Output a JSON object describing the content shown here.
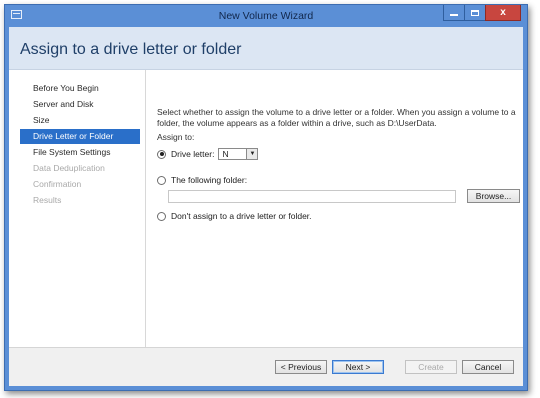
{
  "window": {
    "title": "New Volume Wizard",
    "close_label": "x"
  },
  "header": {
    "title": "Assign to a drive letter or folder"
  },
  "nav": {
    "items": [
      {
        "label": "Before You Begin",
        "state": "normal"
      },
      {
        "label": "Server and Disk",
        "state": "normal"
      },
      {
        "label": "Size",
        "state": "normal"
      },
      {
        "label": "Drive Letter or Folder",
        "state": "active"
      },
      {
        "label": "File System Settings",
        "state": "normal"
      },
      {
        "label": "Data Deduplication",
        "state": "disabled"
      },
      {
        "label": "Confirmation",
        "state": "disabled"
      },
      {
        "label": "Results",
        "state": "disabled"
      }
    ]
  },
  "content": {
    "description": "Select whether to assign the volume to a drive letter or a folder. When you assign a volume to a folder, the volume appears as a folder within a drive, such as D:\\UserData.",
    "assign_to_label": "Assign to:",
    "options": {
      "drive_letter_label": "Drive letter:",
      "drive_letter_value": "N",
      "drive_letter_checked": true,
      "folder_label": "The following folder:",
      "folder_value": "",
      "none_label": "Don't assign to a drive letter or folder."
    },
    "browse_label": "Browse..."
  },
  "footer": {
    "previous_label": "< Previous",
    "next_label": "Next >",
    "create_label": "Create",
    "cancel_label": "Cancel"
  },
  "colors": {
    "titlebar": "#5b8fd6",
    "header_band": "#dce6f3",
    "nav_active": "#2a6fc9",
    "close_button": "#c8463f"
  }
}
